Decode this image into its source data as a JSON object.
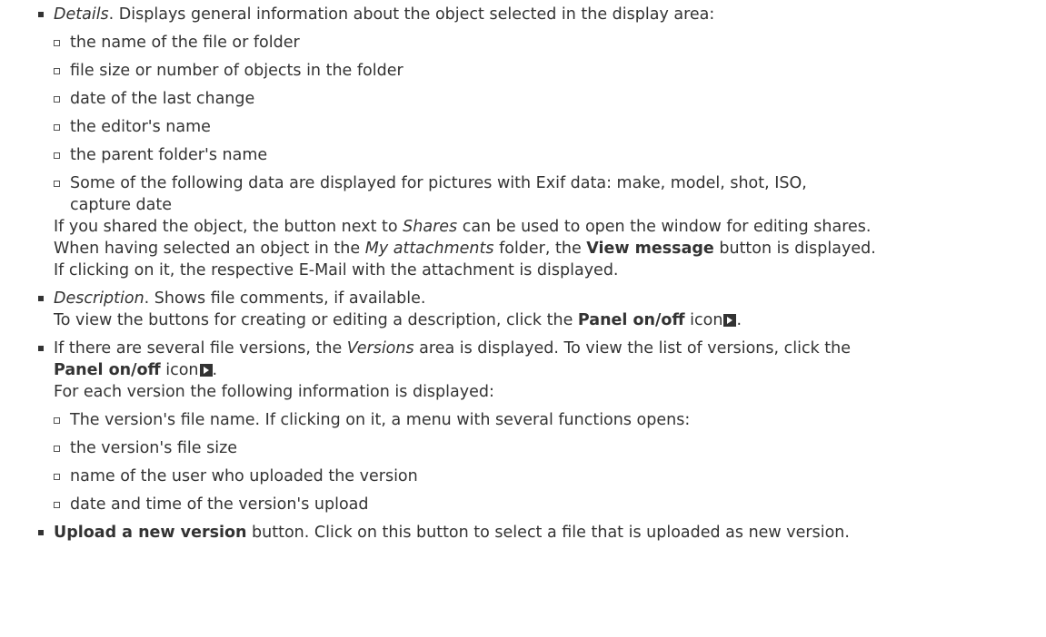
{
  "items": {
    "details": {
      "label": "Details",
      "text": ". Displays general information about the object selected in the display area:",
      "sub": [
        "the name of the file or folder",
        "file size or number of objects in the folder",
        "date of the last change",
        "the editor's name",
        "the parent folder's name",
        "Some of the following data are displayed for pictures with Exif data: make, model, shot, ISO,",
        "capture date"
      ],
      "shares_p1": "If you shared the object, the button next to ",
      "shares_label": "Shares",
      "shares_p2": " can be used to open the window for editing shares.",
      "attach_p1": "When having selected an object in the ",
      "attach_label": "My attachments",
      "attach_p2": " folder, the ",
      "attach_btn": "View message",
      "attach_p3": " button is displayed.",
      "attach_line3": "If clicking on it, the respective E-Mail with the attachment is displayed."
    },
    "description": {
      "label": "Description",
      "text": ". Shows file comments, if available.",
      "line2_p1": "To view the buttons for creating or editing a description, click the ",
      "line2_btn": "Panel on/off",
      "line2_p2": " icon",
      "line2_end": "."
    },
    "versions": {
      "p1": "If there are several file versions, the ",
      "label": "Versions",
      "p2": " area is displayed. To view the list of versions, click the",
      "line2_btn": "Panel on/off",
      "line2_p2": " icon",
      "line2_end": ".",
      "line3": "For each version the following information is displayed:",
      "sub": [
        "The version's file name. If clicking on it, a menu with several functions opens:",
        "the version's file size",
        "name of the user who uploaded the version",
        "date and time of the version's upload"
      ]
    },
    "upload": {
      "btn": "Upload a new version",
      "text": " button. Click on this button to select a file that is uploaded as new version."
    }
  },
  "icons": {
    "panel_toggle": "panel-toggle-icon"
  }
}
